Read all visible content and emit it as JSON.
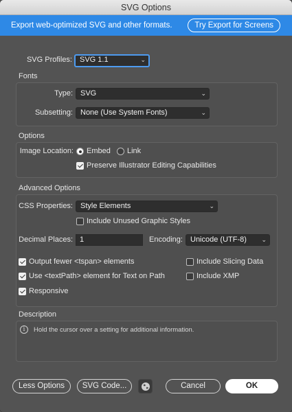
{
  "window": {
    "title": "SVG Options"
  },
  "banner": {
    "text": "Export web-optimized SVG and other formats.",
    "button_label": "Try Export for Screens"
  },
  "svg_profiles": {
    "label": "SVG Profiles:",
    "value": "SVG 1.1"
  },
  "fonts": {
    "section_label": "Fonts",
    "type_label": "Type:",
    "type_value": "SVG",
    "subsetting_label": "Subsetting:",
    "subsetting_value": "None (Use System Fonts)"
  },
  "options": {
    "section_label": "Options",
    "image_location_label": "Image Location:",
    "embed_label": "Embed",
    "embed_selected": true,
    "link_label": "Link",
    "link_selected": false,
    "preserve_label": "Preserve Illustrator Editing Capabilities",
    "preserve_checked": true
  },
  "advanced": {
    "section_label": "Advanced Options",
    "css_label": "CSS Properties:",
    "css_value": "Style Elements",
    "unused_styles_label": "Include Unused Graphic Styles",
    "unused_styles_checked": false,
    "decimal_label": "Decimal Places:",
    "decimal_value": "1",
    "encoding_label": "Encoding:",
    "encoding_value": "Unicode (UTF-8)",
    "tspan_label": "Output fewer <tspan> elements",
    "tspan_checked": true,
    "slicing_label": "Include Slicing Data",
    "slicing_checked": false,
    "textpath_label": "Use <textPath> element for Text on Path",
    "textpath_checked": true,
    "xmp_label": "Include XMP",
    "xmp_checked": false,
    "responsive_label": "Responsive",
    "responsive_checked": true
  },
  "description": {
    "section_label": "Description",
    "text": "Hold the cursor over a setting for additional information."
  },
  "footer": {
    "less_options_label": "Less Options",
    "svg_code_label": "SVG Code...",
    "cancel_label": "Cancel",
    "ok_label": "OK"
  },
  "colors": {
    "banner": "#2e89e6",
    "dialog_bg": "#535353",
    "focus": "#4d9bf0"
  }
}
